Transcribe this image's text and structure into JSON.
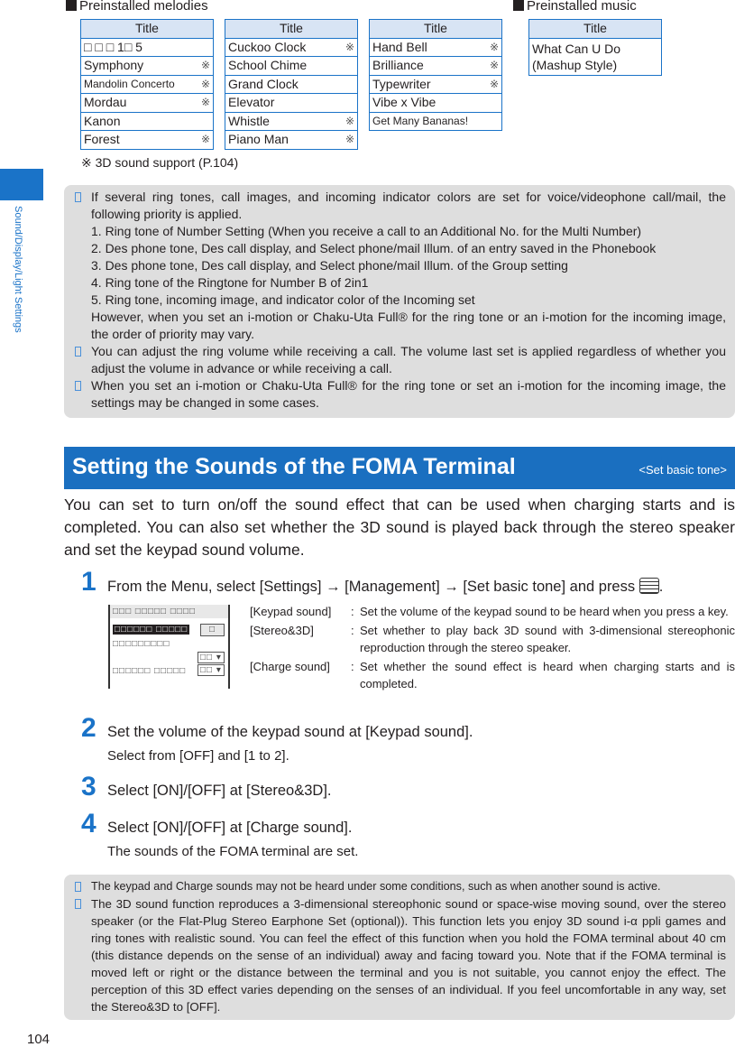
{
  "side_label": "Sound/Display/Light Settings",
  "melodies": {
    "heading": "Preinstalled melodies",
    "tables": [
      {
        "header": "Title",
        "rows": [
          {
            "t": "□ □ □ 1□ 5",
            "m": ""
          },
          {
            "t": "Symphony",
            "m": "※"
          },
          {
            "t": "Mandolin Concerto",
            "m": "※"
          },
          {
            "t": "Mordau",
            "m": "※"
          },
          {
            "t": "Kanon",
            "m": ""
          },
          {
            "t": "Forest",
            "m": "※"
          }
        ]
      },
      {
        "header": "Title",
        "rows": [
          {
            "t": "Cuckoo Clock",
            "m": "※"
          },
          {
            "t": "School Chime",
            "m": ""
          },
          {
            "t": "Grand Clock",
            "m": ""
          },
          {
            "t": "Elevator",
            "m": ""
          },
          {
            "t": "Whistle",
            "m": "※"
          },
          {
            "t": "Piano Man",
            "m": "※"
          }
        ]
      },
      {
        "header": "Title",
        "rows": [
          {
            "t": "Hand Bell",
            "m": "※"
          },
          {
            "t": "Brilliance",
            "m": "※"
          },
          {
            "t": "Typewriter",
            "m": "※"
          },
          {
            "t": "Vibe x Vibe",
            "m": ""
          },
          {
            "t": "Get Many Bananas!",
            "m": ""
          }
        ]
      }
    ],
    "footnote": "※  3D sound support (P.104)"
  },
  "music": {
    "heading": "Preinstalled music",
    "header": "Title",
    "row": "What Can U Do (Mashup Style)"
  },
  "note1": {
    "p1": "If several ring tones, call images, and incoming indicator colors are set for voice/videophone call/mail, the following priority is applied.",
    "list": [
      "1. Ring tone of Number Setting (When you receive a call to an Additional No. for the Multi Number)",
      "2. Des phone tone, Des call display, and Select phone/mail Illum. of an entry saved in the Phonebook",
      "3. Des phone tone, Des call display, and Select phone/mail Illum. of the Group setting",
      "4. Ring tone of the Ringtone for Number B of 2in1",
      "5. Ring tone, incoming image, and indicator color of the Incoming set"
    ],
    "p1b": "However, when you set an i-motion or Chaku-Uta Full® for the ring tone or an i-motion for the incoming image, the order of priority may vary.",
    "p2": "You can adjust the ring volume while receiving a call. The volume last set is applied regardless of whether you adjust the volume in advance or while receiving a call.",
    "p3": "When you set an i-motion or Chaku-Uta Full® for the ring tone or set an i-motion for the incoming image, the settings may be changed in some cases."
  },
  "section": {
    "title": "Setting the Sounds of the FOMA Terminal",
    "tag": "<Set basic tone>",
    "intro": "You can set to turn on/off the sound effect that can be used when charging starts and is completed. You can also set whether the 3D sound is played back through the stereo speaker and set the keypad sound volume."
  },
  "steps": [
    {
      "n": "1",
      "text": "From the Menu, select [Settings] → [Management] → [Set basic tone] and press"
    },
    {
      "n": "2",
      "text": "Set the volume of the keypad sound at [Keypad sound].",
      "sub": "Select from [OFF] and [1 to 2]."
    },
    {
      "n": "3",
      "text": "Select [ON]/[OFF] at [Stereo&3D]."
    },
    {
      "n": "4",
      "text": "Select [ON]/[OFF] at [Charge sound].",
      "sub": "The sounds of the FOMA terminal are set."
    }
  ],
  "screen": {
    "title": "□□□ □□□□□ □□□□",
    "item1": "□□□□□□ □□□□□",
    "val1": "□",
    "item2": "□□□□□□□□□",
    "val2": "□□",
    "item3": "□□□□□□ □□□□□",
    "val3": "□□"
  },
  "settings": [
    {
      "k": "[Keypad sound]",
      "v": "Set the volume of the keypad sound to be heard when you press a key."
    },
    {
      "k": "[Stereo&3D]",
      "v": "Set whether to play back 3D sound with 3-dimensional stereophonic reproduction through the stereo speaker."
    },
    {
      "k": "[Charge sound]",
      "v": "Set whether the sound effect is heard when charging starts and is completed."
    }
  ],
  "note2": {
    "p1": "The keypad and Charge sounds may not be heard under some conditions, such as when another sound is active.",
    "p2": "The 3D sound function reproduces a 3-dimensional stereophonic sound or space-wise moving sound, over the stereo speaker (or the Flat-Plug Stereo Earphone Set (optional)). This function lets you enjoy 3D sound i-α ppli games and ring tones with realistic sound. You can feel the effect of this function when you hold the FOMA terminal about 40 cm (this distance depends on the sense of an individual) away and facing toward you. Note that if the FOMA terminal is moved left or right or the distance between the terminal and you is not suitable, you cannot enjoy the effect. The perception of this 3D effect varies depending on the senses of an individual. If you feel uncomfortable in any way, set the Stereo&3D to [OFF]."
  },
  "page_number": "104",
  "colors": {
    "accent": "#1a6fc0",
    "note_bg": "#dedede"
  }
}
